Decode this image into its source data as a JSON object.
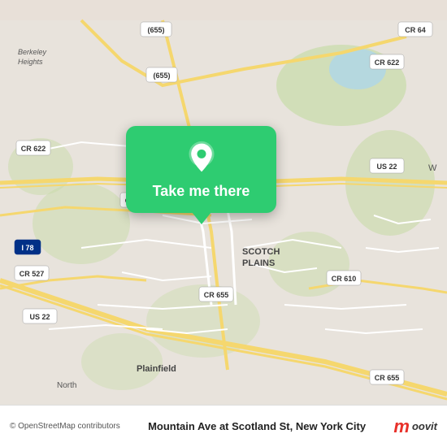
{
  "map": {
    "background_color": "#e8e0d8",
    "attribution": "© OpenStreetMap contributors"
  },
  "popup": {
    "button_label": "Take me there",
    "background_color": "#2ecc71"
  },
  "bottom_bar": {
    "location_name": "Mountain Ave at Scotland St, New York City",
    "moovit_label": "moovit"
  }
}
